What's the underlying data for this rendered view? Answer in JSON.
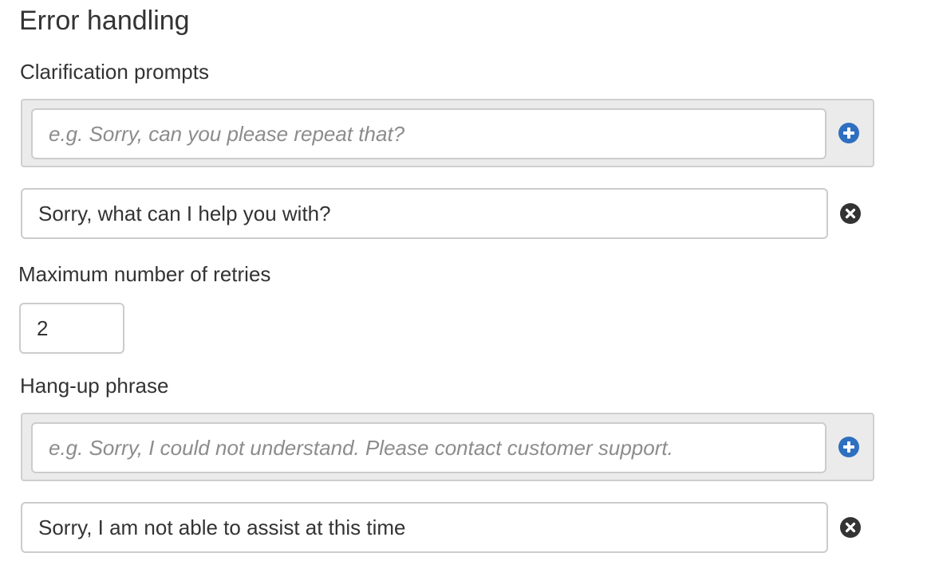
{
  "section": {
    "title": "Error handling"
  },
  "clarification": {
    "label": "Clarification prompts",
    "placeholder": "e.g. Sorry, can you please repeat that?",
    "items": [
      {
        "value": "Sorry, what can I help you with?"
      }
    ]
  },
  "retries": {
    "label": "Maximum number of retries",
    "value": "2"
  },
  "hangup": {
    "label": "Hang-up phrase",
    "placeholder": "e.g. Sorry, I could not understand. Please contact customer support.",
    "items": [
      {
        "value": "Sorry, I am not able to assist at this time"
      }
    ]
  },
  "icons": {
    "add": "plus-circle-icon",
    "remove": "x-circle-icon"
  },
  "colors": {
    "add_icon": "#2e6fc0",
    "remove_icon": "#333333",
    "panel_bg": "#ebebeb",
    "border": "#cccccc"
  }
}
